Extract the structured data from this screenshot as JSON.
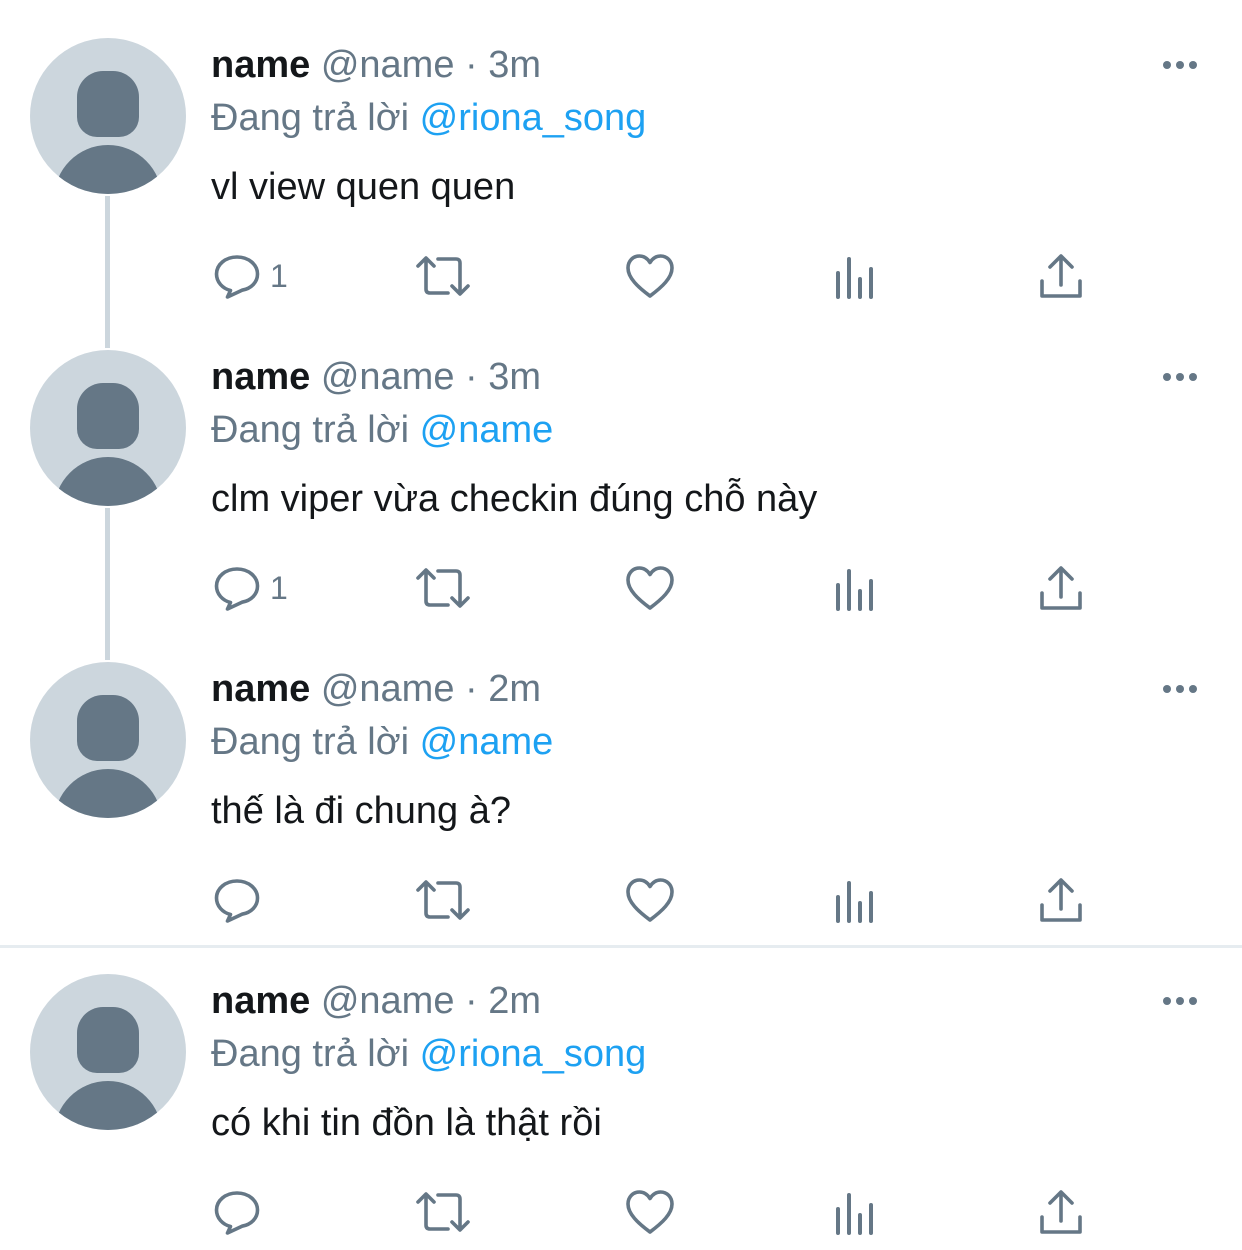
{
  "tweets": [
    {
      "name": "name",
      "handle": "@name",
      "separator": " · ",
      "time": "3m",
      "reply_prefix": "Đang trả lời ",
      "reply_to": "@riona_song",
      "text": "vl view quen quen",
      "reply_count": "1"
    },
    {
      "name": "name",
      "handle": "@name",
      "separator": " · ",
      "time": "3m",
      "reply_prefix": "Đang trả lời ",
      "reply_to": "@name",
      "text": "clm viper vừa checkin đúng chỗ này",
      "reply_count": "1"
    },
    {
      "name": "name",
      "handle": "@name",
      "separator": " · ",
      "time": "2m",
      "reply_prefix": "Đang trả lời ",
      "reply_to": "@name",
      "text": "thế là đi chung à?",
      "reply_count": ""
    },
    {
      "name": "name",
      "handle": "@name",
      "separator": " · ",
      "time": "2m",
      "reply_prefix": "Đang trả lời ",
      "reply_to": "@riona_song",
      "text": "có khi tin đồn là thật rồi",
      "reply_count": ""
    }
  ],
  "icons": {
    "avatar": "default-avatar-icon",
    "more": "more-options-icon",
    "reply": "reply-icon",
    "retweet": "retweet-icon",
    "like": "like-icon",
    "views": "views-icon",
    "share": "share-icon"
  },
  "colors": {
    "accent": "#1da1f2",
    "secondary_text": "#657786",
    "primary_text": "#14171a",
    "avatar_bg": "#ccd6dd",
    "thread_line": "#ccd6dd",
    "divider": "#e6ecf0"
  }
}
